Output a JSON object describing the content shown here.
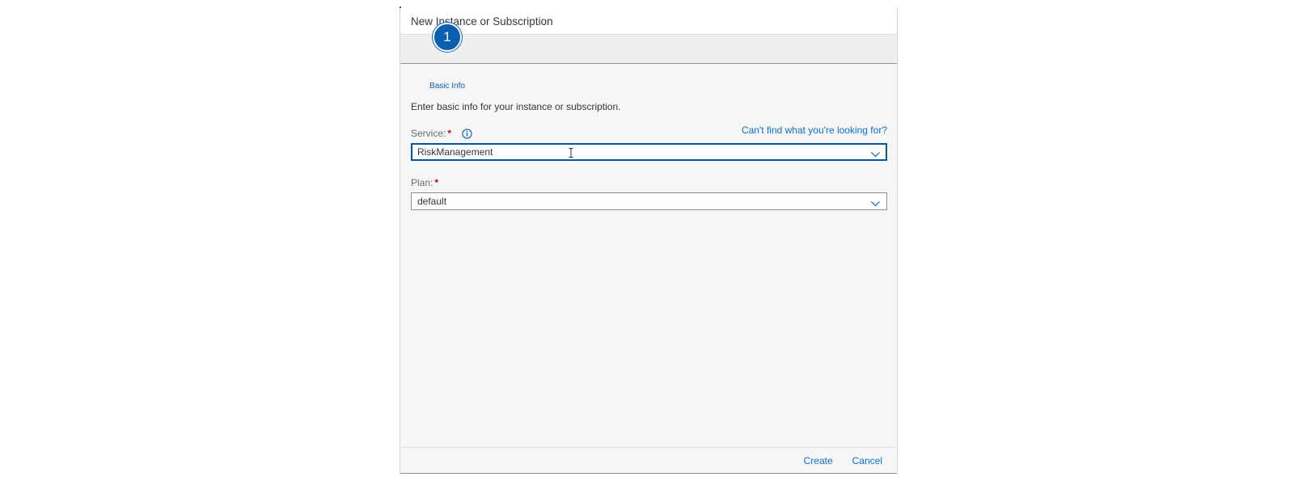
{
  "dialog": {
    "title": "New Instance or Subscription"
  },
  "wizard": {
    "steps": [
      {
        "number": "1",
        "label": "Basic Info",
        "active": true
      }
    ]
  },
  "form": {
    "intro": "Enter basic info for your instance or subscription.",
    "help_link": "Can't find what you're looking for?",
    "service": {
      "label": "Service:",
      "required_mark": "*",
      "value": "RiskManagement",
      "icon": "info-icon"
    },
    "plan": {
      "label": "Plan:",
      "required_mark": "*",
      "value": "default"
    }
  },
  "footer": {
    "create_label": "Create",
    "cancel_label": "Cancel"
  },
  "colors": {
    "accent": "#0a5fb1",
    "link": "#0a6ed1",
    "required": "#d0021b",
    "background": "#f6f6f6"
  }
}
